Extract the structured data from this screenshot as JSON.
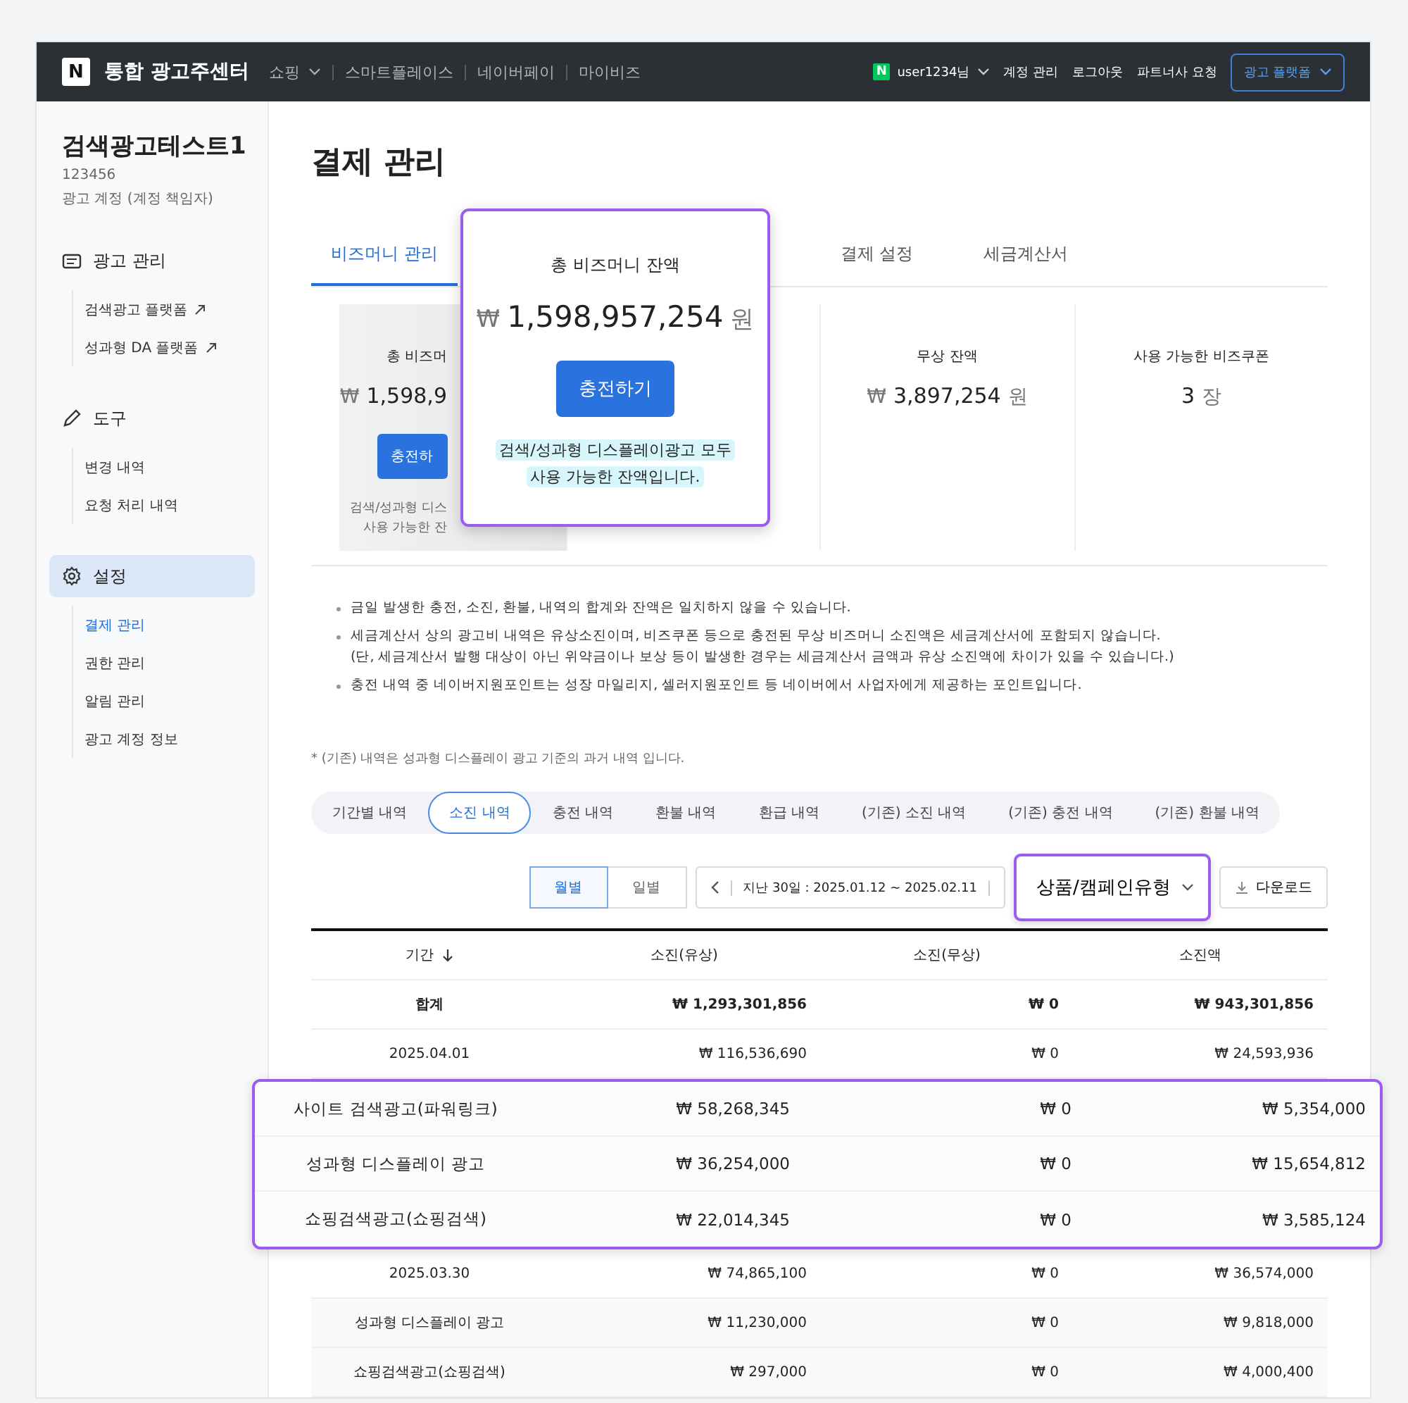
{
  "topbar": {
    "logo": "N",
    "title": "통합 광고주센터",
    "nav": [
      {
        "label": "쇼핑",
        "dropdown": true
      },
      {
        "label": "스마트플레이스",
        "dropdown": false
      },
      {
        "label": "네이버페이",
        "dropdown": false
      },
      {
        "label": "마이비즈",
        "dropdown": false
      }
    ],
    "user": {
      "badge": "N",
      "name": "user1234님"
    },
    "links": [
      "계정 관리",
      "로그아웃",
      "파트너사 요청"
    ],
    "platform_button": "광고 플랫폼"
  },
  "sidebar": {
    "account_name": "검색광고테스트1",
    "account_id": "123456",
    "account_role": "광고 계정 (계정 책임자)",
    "sections": [
      {
        "kind": "ads",
        "title": "광고 관리",
        "selected": false,
        "items": [
          {
            "label": "검색광고 플랫폼",
            "external": true,
            "selected": false
          },
          {
            "label": "성과형 DA 플랫폼",
            "external": true,
            "selected": false
          }
        ]
      },
      {
        "kind": "tools",
        "title": "도구",
        "selected": false,
        "items": [
          {
            "label": "변경 내역",
            "external": false,
            "selected": false
          },
          {
            "label": "요청 처리 내역",
            "external": false,
            "selected": false
          }
        ]
      },
      {
        "kind": "settings",
        "title": "설정",
        "selected": true,
        "items": [
          {
            "label": "결제 관리",
            "external": false,
            "selected": true
          },
          {
            "label": "권한 관리",
            "external": false,
            "selected": false
          },
          {
            "label": "알림 관리",
            "external": false,
            "selected": false
          },
          {
            "label": "광고 계정 정보",
            "external": false,
            "selected": false
          }
        ]
      }
    ]
  },
  "page_title": "결제 관리",
  "tabs": [
    {
      "label": "비즈머니 관리",
      "selected": true
    },
    {
      "label": "결제 설정",
      "selected": false
    },
    {
      "label": "세금계산서",
      "selected": false
    }
  ],
  "summary": {
    "total": {
      "title": "총 비즈머",
      "currency": "₩",
      "amount": "1,598,9",
      "button": "충전하",
      "note_lines": [
        "검색/성과형 디스",
        "사용 가능한 잔"
      ]
    },
    "free": {
      "title": "무상 잔액",
      "currency": "₩",
      "amount": "3,897,254",
      "unit": "원"
    },
    "coupons": {
      "title": "사용 가능한 비즈쿠폰",
      "count": "3",
      "unit": "장"
    }
  },
  "zoom_callout": {
    "title": "총 비즈머니 잔액",
    "currency": "₩",
    "amount": "1,598,957,254",
    "unit": "원",
    "button": "충전하기",
    "note_lines": [
      "검색/성과형 디스플레이광고 모두",
      "사용 가능한 잔액입니다."
    ]
  },
  "notes": [
    {
      "lines": [
        "금일 발생한 충전, 소진, 환불, 내역의 합계와 잔액은 일치하지 않을 수 있습니다."
      ]
    },
    {
      "lines": [
        "세금계산서 상의 광고비 내역은 유상소진이며, 비즈쿠폰 등으로 충전된 무상 비즈머니 소진액은 세금계산서에 포함되지 않습니다.",
        "(단, 세금계산서 발행 대상이 아닌 위약금이나 보상 등이 발생한 경우는 세금계산서 금액과 유상 소진액에 차이가 있을 수 있습니다.)"
      ]
    },
    {
      "lines": [
        "충전 내역 중 네이버지원포인트는 성장 마일리지, 셀러지원포인트 등 네이버에서 사업자에게 제공하는 포인트입니다."
      ]
    }
  ],
  "footnote": "* (기존) 내역은 성과형 디스플레이 광고 기준의 과거 내역 입니다.",
  "history_tabs": [
    {
      "label": "기간별 내역",
      "selected": false
    },
    {
      "label": "소진 내역",
      "selected": true
    },
    {
      "label": "충전 내역",
      "selected": false
    },
    {
      "label": "환불 내역",
      "selected": false
    },
    {
      "label": "환급 내역",
      "selected": false
    },
    {
      "label": "(기존) 소진 내역",
      "selected": false
    },
    {
      "label": "(기존) 충전 내역",
      "selected": false
    },
    {
      "label": "(기존) 환불 내역",
      "selected": false
    }
  ],
  "toolbar": {
    "period_toggle": [
      {
        "label": "월별",
        "selected": true
      },
      {
        "label": "일별",
        "selected": false
      }
    ],
    "date_range": "지난 30일 : 2025.01.12 ~ 2025.02.11",
    "group_dropdown": "상품/캠페인유형",
    "download": "다운로드"
  },
  "table": {
    "columns": [
      {
        "label": "기간",
        "sorted": true
      },
      {
        "label": "소진(유상)",
        "sorted": false
      },
      {
        "label": "소진(무상)",
        "sorted": false
      },
      {
        "label": "소진액",
        "sorted": false
      }
    ],
    "rows": [
      {
        "kind": "total",
        "cells": [
          "합계",
          "₩ 1,293,301,856",
          "₩ 0",
          "₩ 943,301,856"
        ]
      },
      {
        "kind": "date",
        "cells": [
          "2025.04.01",
          "₩ 116,536,690",
          "₩ 0",
          "₩ 24,593,936"
        ]
      },
      {
        "kind": "zoomed",
        "cells": [
          "사이트 검색광고(파워링크)",
          "₩ 58,268,345",
          "₩ 0",
          "₩ 5,354,000"
        ]
      },
      {
        "kind": "zoomed",
        "cells": [
          "성과형 디스플레이 광고",
          "₩ 36,254,000",
          "₩ 0",
          "₩ 15,654,812"
        ]
      },
      {
        "kind": "zoomed",
        "cells": [
          "쇼핑검색광고(쇼핑검색)",
          "₩ 22,014,345",
          "₩ 0",
          "₩ 3,585,124"
        ]
      },
      {
        "kind": "date",
        "cells": [
          "2025.03.30",
          "₩ 74,865,100",
          "₩ 0",
          "₩ 36,574,000"
        ]
      },
      {
        "kind": "sub",
        "cells": [
          "성과형 디스플레이 광고",
          "₩ 11,230,000",
          "₩ 0",
          "₩ 9,818,000"
        ]
      },
      {
        "kind": "sub",
        "cells": [
          "쇼핑검색광고(쇼핑검색)",
          "₩ 297,000",
          "₩ 0",
          "₩ 4,000,400"
        ]
      }
    ]
  }
}
